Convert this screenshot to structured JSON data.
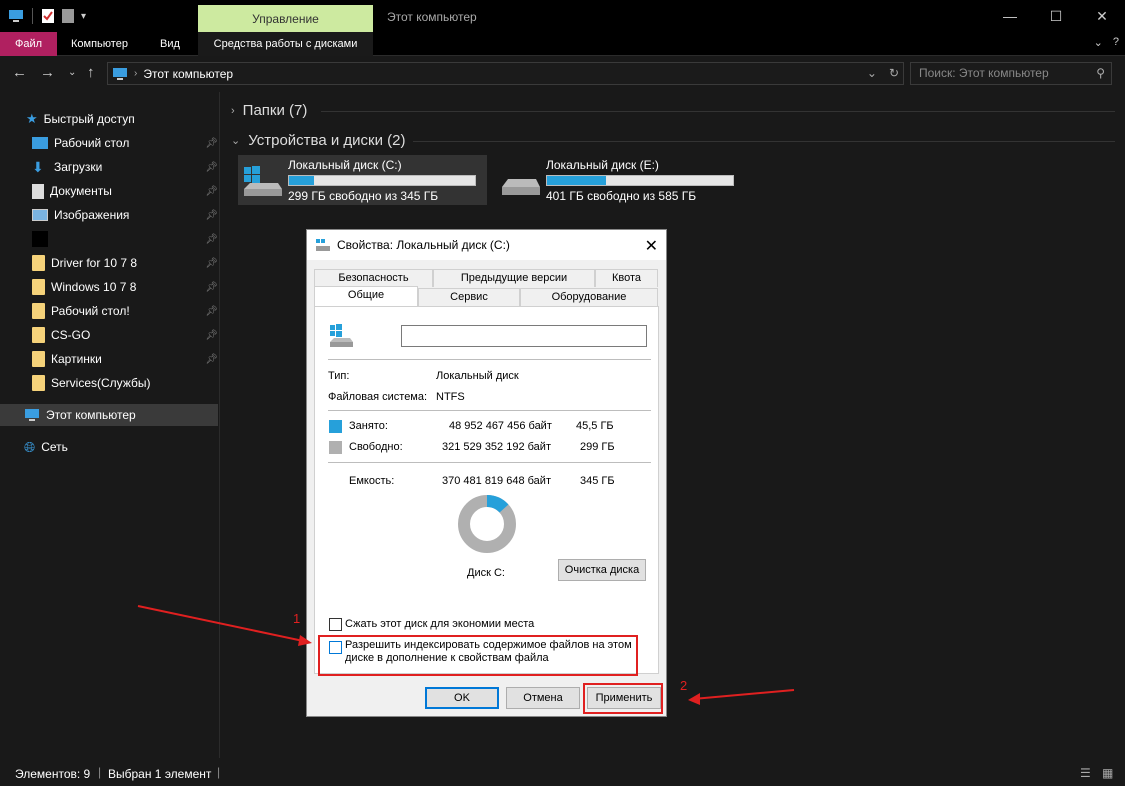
{
  "titlebar": {
    "context_tab": "Управление",
    "title": "Этот компьютер",
    "minimize": "—",
    "maximize": "☐",
    "close": "✕"
  },
  "ribbon": {
    "tabs": [
      "Файл",
      "Компьютер",
      "Вид",
      "Средства работы с дисками"
    ],
    "expand": "⌄",
    "help": "?"
  },
  "address": {
    "path": "Этот компьютер",
    "search_placeholder": "Поиск: Этот компьютер"
  },
  "sidebar": {
    "quick_access": "Быстрый доступ",
    "items": [
      {
        "label": "Рабочий стол",
        "icon": "desktop-icon",
        "pinned": true
      },
      {
        "label": "Загрузки",
        "icon": "download-icon",
        "pinned": true
      },
      {
        "label": "Документы",
        "icon": "documents-icon",
        "pinned": true
      },
      {
        "label": "Изображения",
        "icon": "pictures-icon",
        "pinned": true
      },
      {
        "label": "",
        "icon": "black-folder-icon",
        "pinned": true
      },
      {
        "label": "Driver for 10 7 8",
        "icon": "folder-icon",
        "pinned": true
      },
      {
        "label": "Windows 10 7 8",
        "icon": "folder-icon",
        "pinned": true
      },
      {
        "label": "Рабочий стол!",
        "icon": "folder-icon",
        "pinned": true
      },
      {
        "label": "CS-GO",
        "icon": "folder-icon",
        "pinned": true
      },
      {
        "label": "Картинки",
        "icon": "folder-icon",
        "pinned": true
      },
      {
        "label": "Services(Службы)",
        "icon": "folder-icon",
        "pinned": false
      }
    ],
    "this_pc": "Этот компьютер",
    "network": "Сеть"
  },
  "main": {
    "folders_group": "Папки (7)",
    "devices_group": "Устройства и диски (2)",
    "drives": [
      {
        "name": "Локальный диск (C:)",
        "free": "299 ГБ свободно из 345 ГБ",
        "used_fraction": 0.133
      },
      {
        "name": "Локальный диск (E:)",
        "free": "401 ГБ свободно из 585 ГБ",
        "used_fraction": 0.315
      }
    ]
  },
  "status": {
    "elements": "Элементов: 9",
    "selected": "Выбран 1 элемент"
  },
  "dialog": {
    "title": "Свойства: Локальный диск (C:)",
    "tabs_row1": [
      "Безопасность",
      "Предыдущие версии",
      "Квота"
    ],
    "tabs_row2": [
      "Общие",
      "Сервис",
      "Оборудование"
    ],
    "type_label": "Тип:",
    "type_value": "Локальный диск",
    "fs_label": "Файловая система:",
    "fs_value": "NTFS",
    "used_label": "Занято:",
    "used_bytes": "48 952 467 456 байт",
    "used_gb": "45,5 ГБ",
    "free_label": "Свободно:",
    "free_bytes": "321 529 352 192 байт",
    "free_gb": "299 ГБ",
    "capacity_label": "Емкость:",
    "capacity_bytes": "370 481 819 648 байт",
    "capacity_gb": "345 ГБ",
    "disk_label": "Диск C:",
    "cleanup_button": "Очистка диска",
    "compress_label": "Сжать этот диск для экономии места",
    "index_label_1": "Разрешить индексировать содержимое файлов на этом",
    "index_label_2": "диске в дополнение к свойствам файла",
    "ok": "OK",
    "cancel": "Отмена",
    "apply": "Применить",
    "used_fraction": 0.132,
    "used_color": "#26a0da",
    "free_color": "#b0b0b0"
  },
  "annotations": {
    "marker_1": "1",
    "marker_2": "2",
    "color": "#e02020"
  }
}
